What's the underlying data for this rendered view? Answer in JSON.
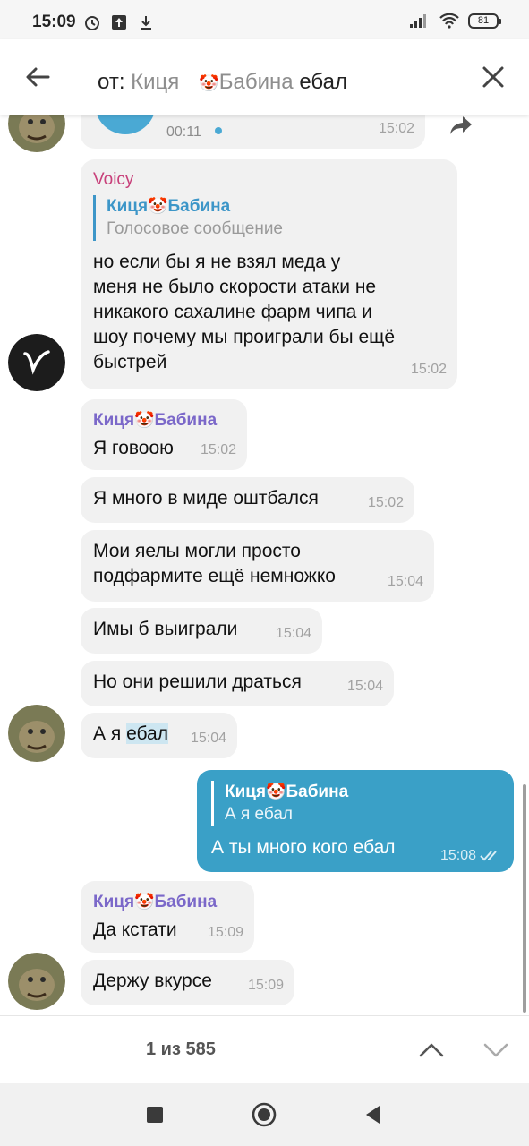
{
  "status_bar": {
    "time": "15:09",
    "battery": "81"
  },
  "search": {
    "prefix": "от:",
    "filter_user": "Кицяﾠ🤡Бабина",
    "filter_user_name_a": "Кицяﾠ",
    "filter_user_name_b": "Бабина",
    "query": "ебал"
  },
  "clown_emoji": "🤡",
  "messages": {
    "voice_top": {
      "duration": "00:11",
      "time": "15:02"
    },
    "voicy": {
      "sender": "Voicy",
      "reply_name_a": "Киця",
      "reply_name_b": "Бабина",
      "reply_text": "Голосовое сообщение",
      "line1": "но если бы я не взял меда у",
      "line2": "меня не было скорости атаки не",
      "line3": "никакого сахалине фарм чипа и",
      "line4": "шоу почему мы проиграли бы ещё",
      "line5": "быстрей",
      "time": "15:02"
    },
    "m1": {
      "sender_a": "Киця",
      "sender_b": "Бабина",
      "text": "Я говоою",
      "time": "15:02"
    },
    "m2": {
      "text": "Я много в миде оштбался",
      "time": "15:02"
    },
    "m3": {
      "line1": "Мои яелы могли просто",
      "line2": "подфармите ещё немножко",
      "time": "15:04"
    },
    "m4": {
      "text": "Имы б выиграли",
      "time": "15:04"
    },
    "m5": {
      "text": "Но они решили драться",
      "time": "15:04"
    },
    "m6": {
      "text_pre": "А я ",
      "text_highlight": "ебал",
      "time": "15:04"
    },
    "out": {
      "reply_name_a": "Киця",
      "reply_name_b": "Бабина",
      "reply_text": "А я ебал",
      "text": "А ты много кого ебал",
      "time": "15:08"
    },
    "m7": {
      "sender_a": "Киця",
      "sender_b": "Бабина",
      "text": "Да кстати",
      "time": "15:09"
    },
    "m8": {
      "text": "Держу вкурсе",
      "time": "15:09"
    }
  },
  "bottom": {
    "counter": "1 из 585"
  },
  "colors": {
    "accent": "#3aa0c7",
    "sender_name": "#7b68c9",
    "voicy_name": "#c8407a",
    "reply_bar": "#3d96c8"
  }
}
